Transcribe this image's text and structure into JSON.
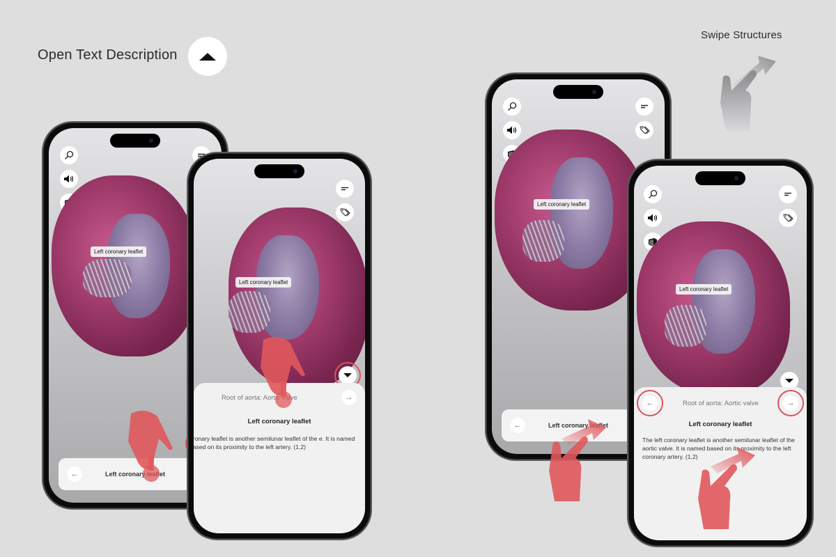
{
  "captions": {
    "open_text": "Open Text Description",
    "swipe": "Swipe Structures"
  },
  "icons": {
    "search": "search-icon",
    "audio": "speaker-icon",
    "layers": "layers-icon",
    "menu": "menu-icon",
    "tags": "tag-icon",
    "expand": "triangle-up-icon",
    "collapse": "triangle-down-icon",
    "prev": "arrow-left-icon",
    "next": "arrow-right-icon",
    "gesture": "hand-gesture-icon"
  },
  "colors": {
    "accent_red": "#d9545c",
    "background": "#dededf",
    "heart_tissue": "#9e3a6a"
  },
  "phones": [
    {
      "id": "phone-1",
      "structure_label": "Left coronary leaflet",
      "navbar": {
        "title": "Left coronary leaflet",
        "prev": "←",
        "next": "→"
      }
    },
    {
      "id": "phone-2",
      "structure_label": "Left coronary leaflet",
      "panel": {
        "breadcrumb": "Root of aorta: Aortic valve",
        "title": "Left coronary leaflet",
        "body": "oronary leaflet is another semilunar leaflet of the e. It is named based on its proximity to the left artery. (1,2)",
        "next": "→"
      }
    },
    {
      "id": "phone-3",
      "structure_label": "Left coronary leaflet",
      "navbar": {
        "title": "Left coronary leaflet",
        "prev": "←"
      }
    },
    {
      "id": "phone-4",
      "structure_label": "Left coronary leaflet",
      "panel": {
        "breadcrumb": "Root of aorta: Aortic valve",
        "title": "Left coronary leaflet",
        "body": "The left coronary leaflet is another semilunar leaflet of the aortic valve. It is named based on its proximity to the left coronary artery. (1,2)",
        "prev": "←",
        "next": "→"
      }
    }
  ]
}
